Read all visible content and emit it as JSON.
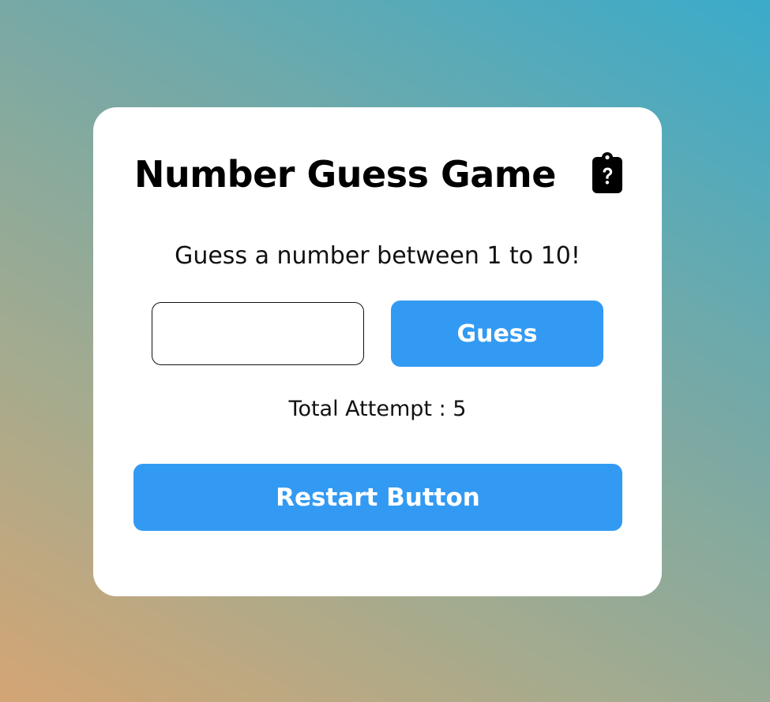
{
  "game": {
    "title": "Number Guess Game",
    "header_icon": "clipboard-question-icon",
    "prompt": "Guess a number between 1 to 10!",
    "input": {
      "value": "",
      "placeholder": ""
    },
    "guess_label": "Guess",
    "attempt_text": "Total Attempt : 5",
    "restart_label": "Restart Button"
  },
  "colors": {
    "accent": "#339af3",
    "card": "#ffffff",
    "background_start": "#d4a574",
    "background_end": "#3aabca"
  }
}
